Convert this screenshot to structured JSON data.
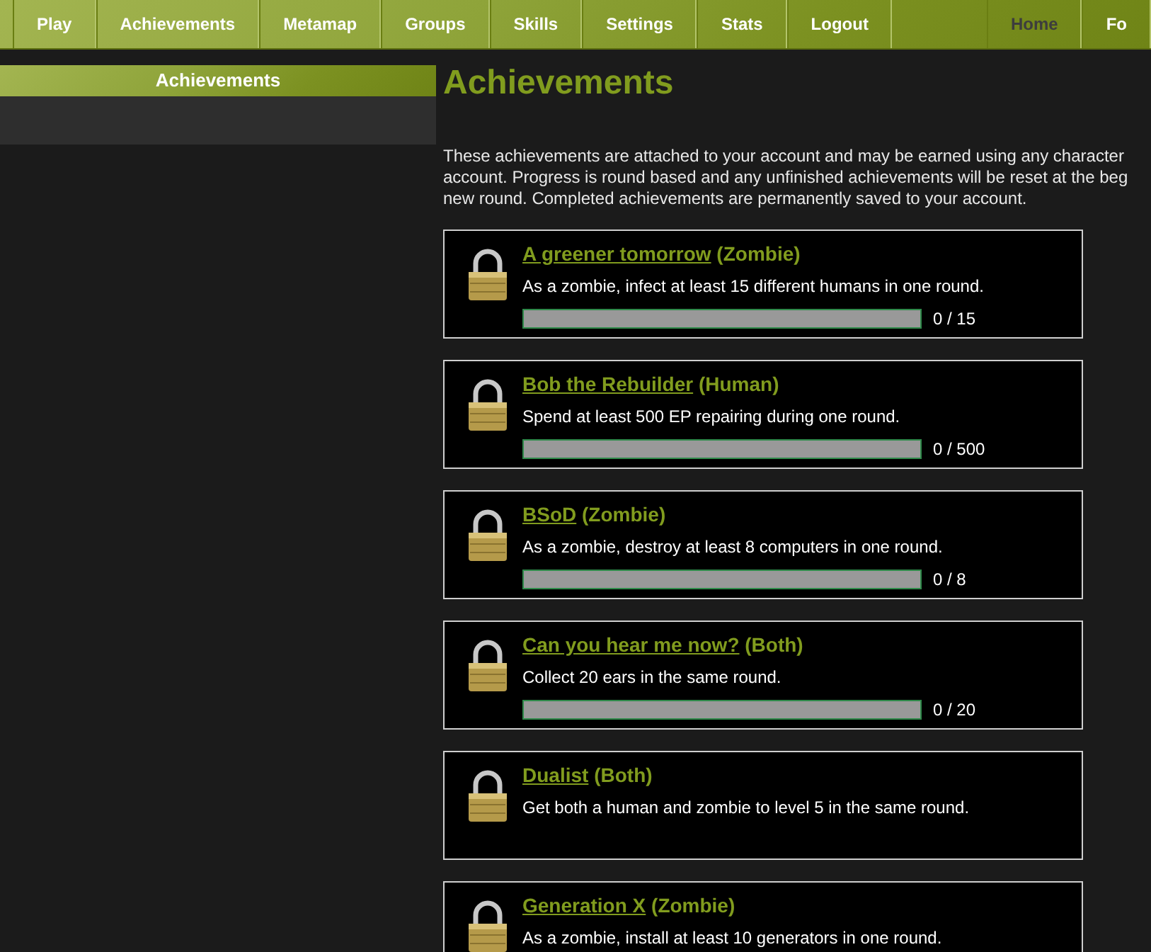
{
  "nav": {
    "items": [
      {
        "label": "Play",
        "selected": false
      },
      {
        "label": "Achievements",
        "selected": false
      },
      {
        "label": "Metamap",
        "selected": false
      },
      {
        "label": "Groups",
        "selected": false
      },
      {
        "label": "Skills",
        "selected": false
      },
      {
        "label": "Settings",
        "selected": false
      },
      {
        "label": "Stats",
        "selected": false
      },
      {
        "label": "Logout",
        "selected": false
      }
    ],
    "right_items": [
      {
        "label": "Home",
        "selected": true
      },
      {
        "label": "Fo",
        "selected": false
      }
    ]
  },
  "sidebar": {
    "title": "Achievements"
  },
  "main": {
    "heading": "Achievements",
    "intro": "These achievements are attached to your account and may be earned using any character\naccount. Progress is round based and any unfinished achievements will be reset at the beg\nnew round. Completed achievements are permanently saved to your account.",
    "achievements": [
      {
        "name": "A greener tomorrow",
        "side": "(Zombie)",
        "description": "As a zombie, infect at least 15 different humans in one round.",
        "progress": {
          "level": 0,
          "reading": "0 / 15"
        }
      },
      {
        "name": "Bob the Rebuilder",
        "side": "(Human)",
        "description": "Spend at least 500 EP repairing during one round.",
        "progress": {
          "level": 0,
          "reading": "0 / 500"
        }
      },
      {
        "name": "BSoD",
        "side": "(Zombie)",
        "description": "As a zombie, destroy at least 8 computers in one round.",
        "progress": {
          "level": 0,
          "reading": "0 / 8"
        }
      },
      {
        "name": "Can you hear me now?",
        "side": "(Both)",
        "description": "Collect 20 ears in the same round.",
        "progress": {
          "level": 0,
          "reading": "0 / 20"
        }
      },
      {
        "name": "Dualist",
        "side": "(Both)",
        "description": "Get both a human and zombie to level 5 in the same round."
      },
      {
        "name": "Generation X",
        "side": "(Zombie)",
        "description": "As a zombie, install at least 10 generators in one round."
      }
    ]
  }
}
